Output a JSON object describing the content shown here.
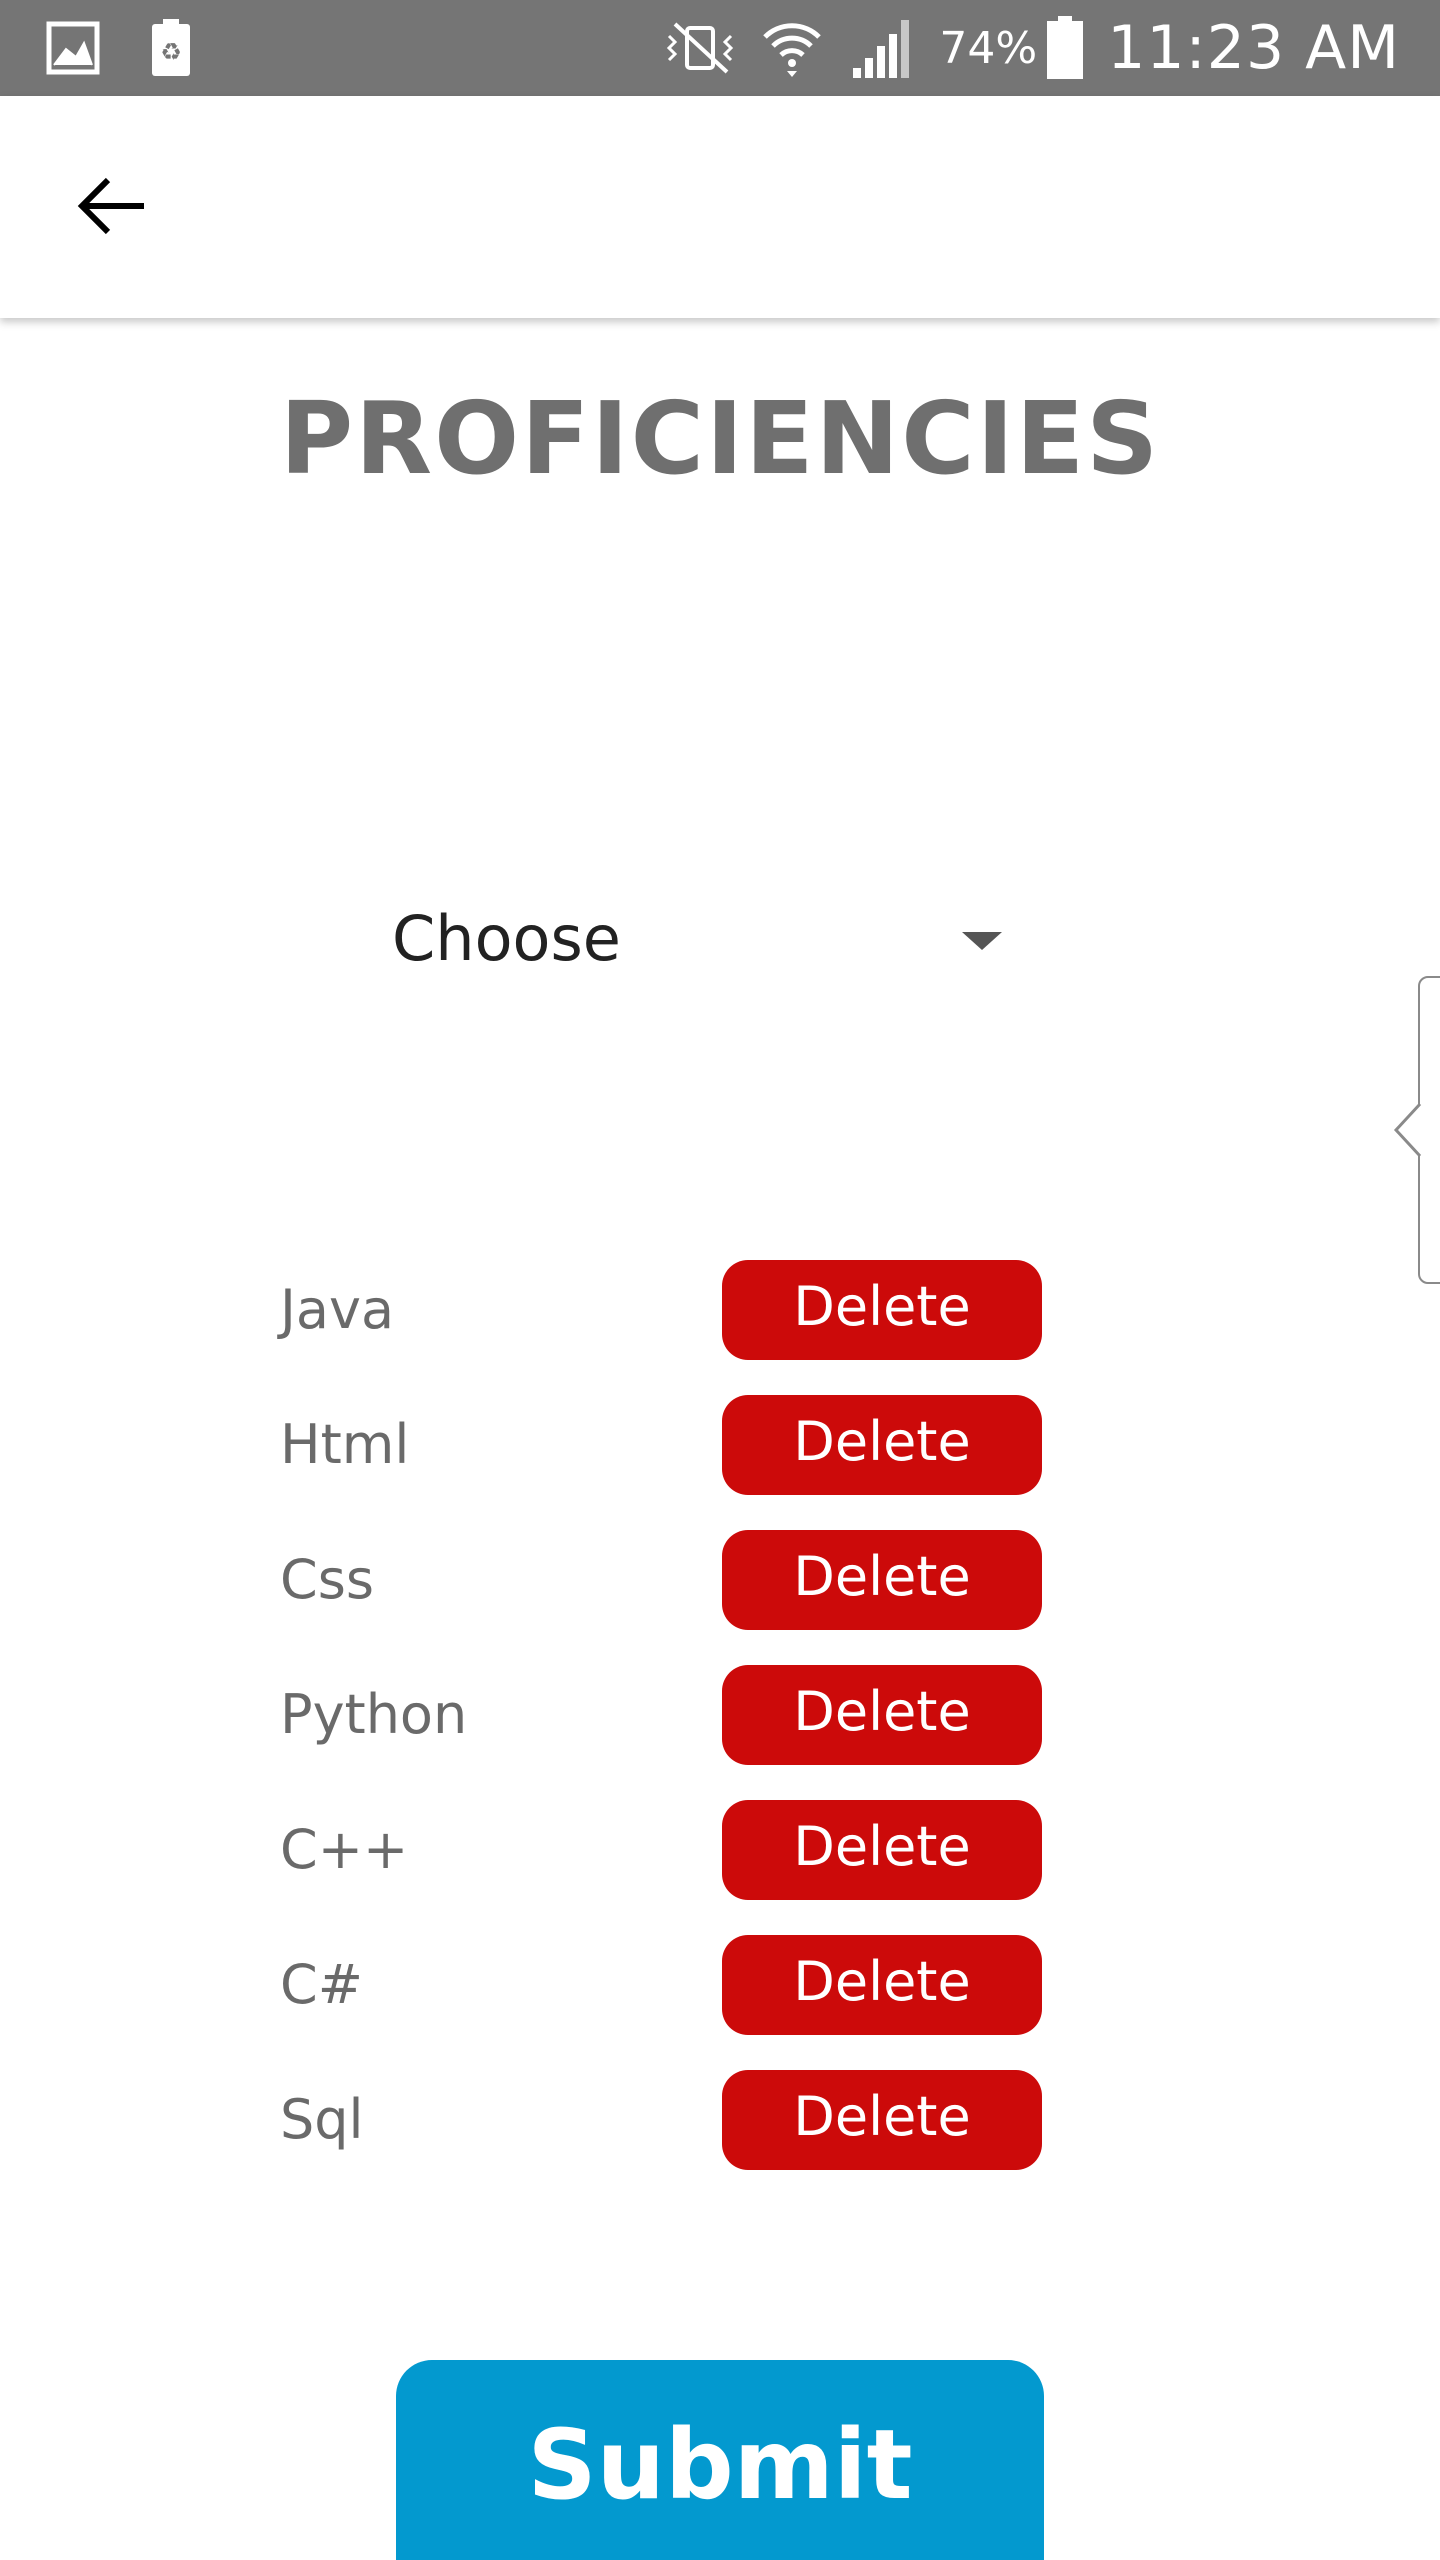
{
  "status_bar": {
    "left_icons": [
      "image-icon",
      "recycle-battery-icon"
    ],
    "right_icons": [
      "vibrate-mute-icon",
      "wifi-icon",
      "signal-icon",
      "battery-icon"
    ],
    "battery_percent": "74%",
    "time": "11:23 AM",
    "background_color": "#757575"
  },
  "app_bar": {
    "back_icon": "arrow-back-icon"
  },
  "page": {
    "title": "PROFICIENCIES"
  },
  "dropdown": {
    "selected": "Choose",
    "caret_icon": "caret-down-icon"
  },
  "proficiencies": [
    {
      "name": "Java",
      "delete_label": "Delete"
    },
    {
      "name": "Html",
      "delete_label": "Delete"
    },
    {
      "name": "Css",
      "delete_label": "Delete"
    },
    {
      "name": "Python",
      "delete_label": "Delete"
    },
    {
      "name": "C++",
      "delete_label": "Delete"
    },
    {
      "name": "C#",
      "delete_label": "Delete"
    },
    {
      "name": "Sql",
      "delete_label": "Delete"
    }
  ],
  "submit": {
    "label": "Submit"
  },
  "colors": {
    "delete": "#cc0a0a",
    "submit": "#0399cf",
    "title": "#6f6f6f"
  }
}
